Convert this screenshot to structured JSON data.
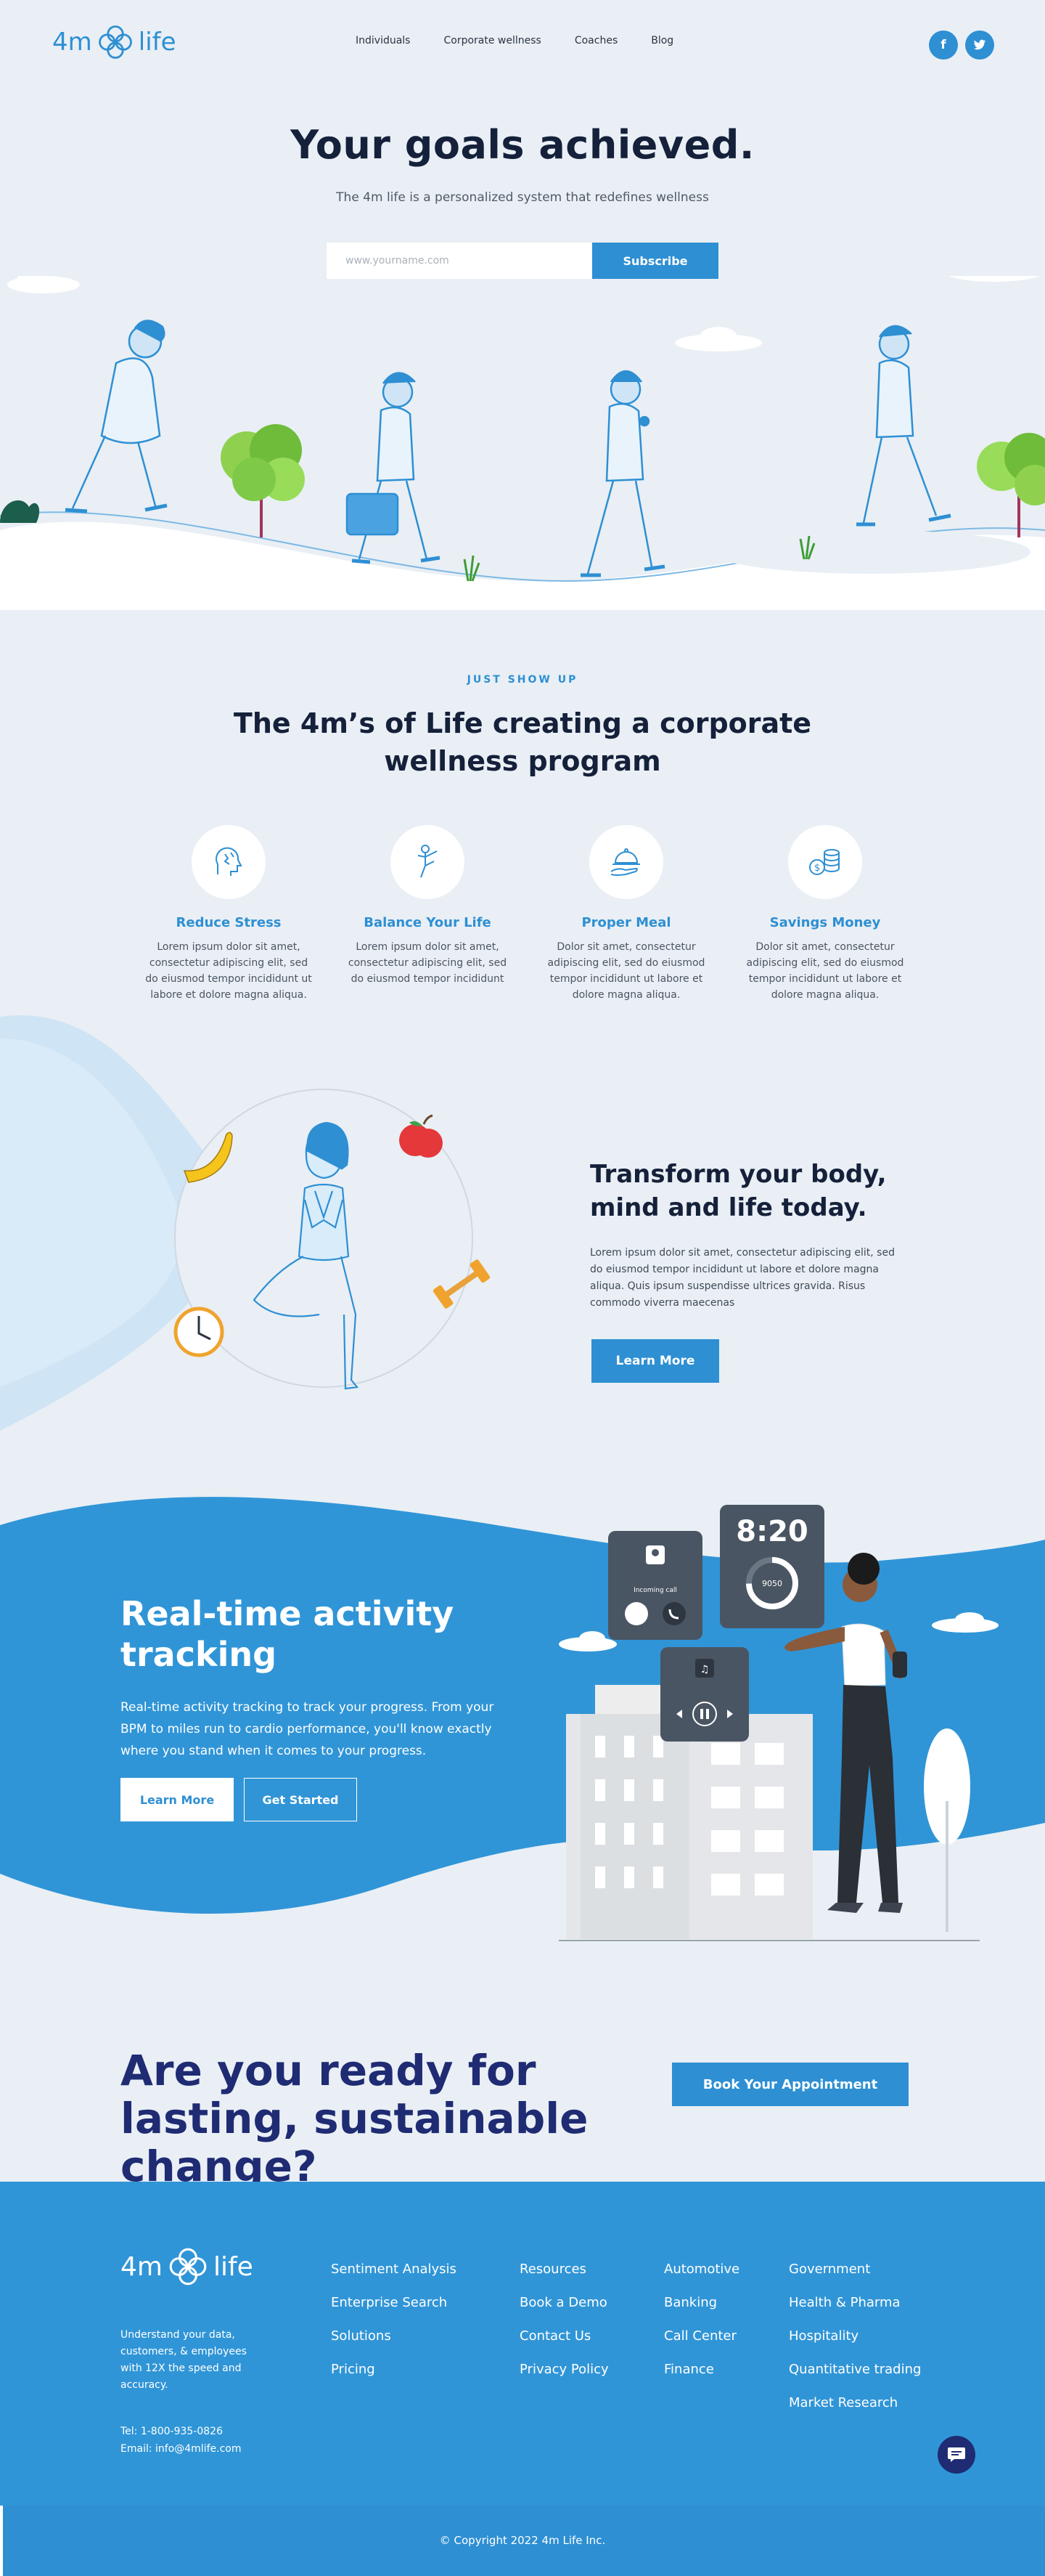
{
  "brand": {
    "name": "life",
    "prefix": "4m",
    "color": "#2e8fd3"
  },
  "nav": {
    "links": [
      "Individuals",
      "Corporate wellness",
      "Coaches",
      "Blog"
    ],
    "social": [
      {
        "icon": "facebook-icon",
        "glyph": "f"
      },
      {
        "icon": "twitter-icon",
        "glyph": "t"
      }
    ]
  },
  "hero": {
    "title": "Your goals achieved.",
    "subtitle": "The 4m life is a personalized system that redefines wellness",
    "email_placeholder": "www.yourname.com",
    "subscribe_label": "Subscribe"
  },
  "program": {
    "eyebrow": "JUST SHOW UP",
    "title": "The 4m’s of Life creating a corporate wellness program",
    "features": [
      {
        "icon": "stress-head-icon",
        "title": "Reduce Stress",
        "text": "Lorem ipsum dolor sit amet, consectetur adipiscing elit, sed do eiusmod tempor incididunt ut labore et dolore magna aliqua."
      },
      {
        "icon": "yoga-balance-icon",
        "title": "Balance Your Life",
        "text": "Lorem ipsum dolor sit amet, consectetur adipiscing elit, sed do eiusmod tempor incididunt"
      },
      {
        "icon": "meal-cloche-icon",
        "title": "Proper Meal",
        "text": "Dolor sit amet, consectetur adipiscing elit, sed do eiusmod tempor incididunt ut labore et dolore magna aliqua."
      },
      {
        "icon": "coins-icon",
        "title": "Savings Money",
        "text": "Dolor sit amet, consectetur adipiscing elit, sed do eiusmod tempor incididunt ut labore et dolore magna aliqua."
      }
    ]
  },
  "transform": {
    "title": "Transform your body, mind and life today.",
    "text": "Lorem ipsum dolor sit amet, consectetur adipiscing elit, sed do eiusmod tempor incididunt ut labore et dolore magna aliqua. Quis ipsum suspendisse ultrices gravida. Risus commodo viverra maecenas",
    "button": "Learn More"
  },
  "realtime": {
    "title": "Real-time activity tracking",
    "text": "Real-time activity tracking to track your progress.  From your BPM to miles run to cardio performance, you'll know exactly where you stand when it comes to your progress.",
    "learn_more": "Learn More",
    "get_started": "Get Started",
    "watch_time": "8:20",
    "steps": "9050",
    "call_label": "Incoming call"
  },
  "cta": {
    "title": "Are you ready for lasting, sustainable change?",
    "button": "Book Your Appointment"
  },
  "footer": {
    "about": "Understand your data, customers, & employees with 12X the speed and accuracy.",
    "tel": "Tel: 1-800-935-0826",
    "email": "Email: info@4mlife.com",
    "col1": [
      "Sentiment Analysis",
      "Enterprise Search",
      "Solutions",
      "Pricing"
    ],
    "col2": [
      "Resources",
      "Book a Demo",
      "Contact Us",
      "Privacy Policy"
    ],
    "col3": [
      "Automotive",
      "Banking",
      "Call Center",
      "Finance"
    ],
    "col4": [
      "Government",
      "Health & Pharma",
      "Hospitality",
      "Quantitative trading",
      "Market Research"
    ],
    "copyright": "© Copyright 2022 4m Life  Inc."
  }
}
